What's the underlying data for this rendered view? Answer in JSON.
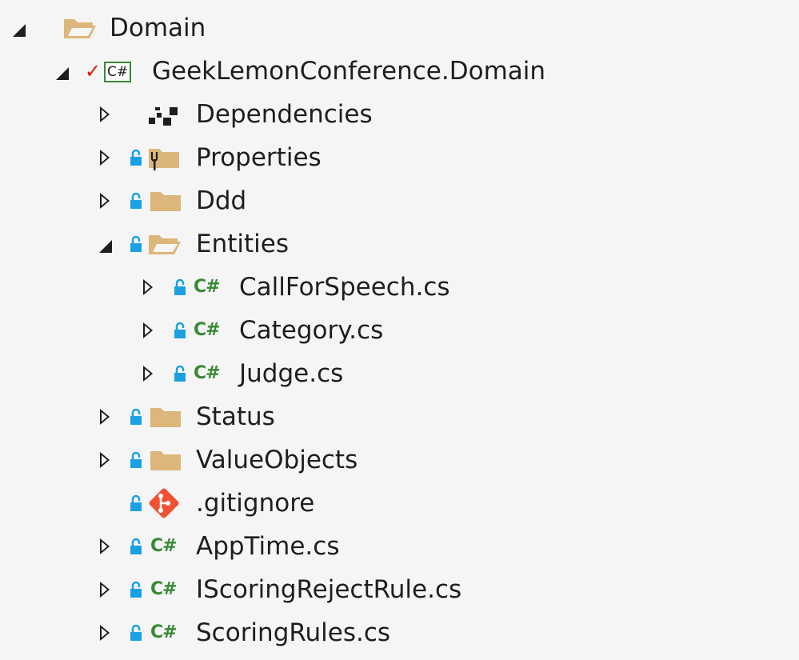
{
  "tree": {
    "domain_folder": "Domain",
    "project": "GeekLemonConference.Domain",
    "project_badge": "C#",
    "cs_glyph": "C#",
    "items": [
      {
        "label": "Dependencies"
      },
      {
        "label": "Properties"
      },
      {
        "label": "Ddd"
      },
      {
        "label": "Entities"
      },
      {
        "label": "CallForSpeech.cs"
      },
      {
        "label": "Category.cs"
      },
      {
        "label": "Judge.cs"
      },
      {
        "label": "Status"
      },
      {
        "label": "ValueObjects"
      },
      {
        "label": ".gitignore"
      },
      {
        "label": "AppTime.cs"
      },
      {
        "label": "IScoringRejectRule.cs"
      },
      {
        "label": "ScoringRules.cs"
      }
    ]
  },
  "icons": {
    "expanded_arrow": "triangle-expanded-icon",
    "collapsed_arrow": "triangle-collapsed-icon",
    "folder": "folder-icon",
    "folder_open": "folder-open-icon",
    "lock": "lock-icon",
    "csharp": "csharp-file-icon",
    "git": "git-icon",
    "dependencies": "dependencies-icon",
    "checkmark": "checkmark-icon"
  },
  "colors": {
    "background": "#f5f5f5",
    "text": "#1e1e1e",
    "folder": "#dcb67a",
    "lock": "#1ba1e2",
    "csharp": "#388a34",
    "git": "#f05033",
    "checkmark": "#e51400"
  }
}
